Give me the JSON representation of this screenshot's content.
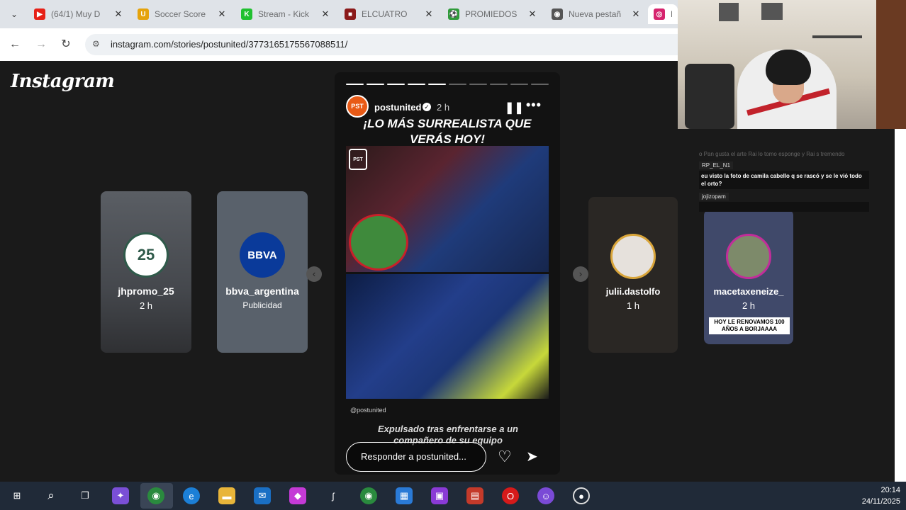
{
  "browser": {
    "tabs": [
      {
        "label": "(64/1) Muy D",
        "icon": "youtube-icon",
        "color": "#e62117",
        "glyph": "▶"
      },
      {
        "label": "Soccer Score",
        "icon": "soccer-score-icon",
        "color": "#e5a30b",
        "glyph": "U"
      },
      {
        "label": "Stream - Kick",
        "icon": "kick-icon",
        "color": "#20c030",
        "glyph": "K"
      },
      {
        "label": "ELCUATRO",
        "icon": "elcuatro-icon",
        "color": "#8b1a1a",
        "glyph": "■"
      },
      {
        "label": "PROMIEDOS",
        "icon": "promiedos-icon",
        "color": "#2f9b3a",
        "glyph": "⚽"
      },
      {
        "label": "Nueva pestañ",
        "icon": "chrome-icon",
        "color": "#555555",
        "glyph": "◉"
      },
      {
        "label": "H",
        "icon": "instagram-icon",
        "color": "#d6246e",
        "glyph": "◎"
      }
    ],
    "url": "instagram.com/stories/postunited/3773165175567088511/"
  },
  "instagram": {
    "logo": "Instagram",
    "left_stories": [
      {
        "name": "jhpromo_25",
        "sub": "2 h",
        "avatar_text": "25"
      },
      {
        "name": "bbva_argentina",
        "sub": "Publicidad",
        "avatar_text": "BBVA"
      }
    ],
    "story": {
      "user": "postunited",
      "avatar_text": "PST",
      "time": "2 h",
      "headline": "¡LO MÁS SURREALISTA QUE VERÁS HOY!",
      "watermark": "@postunited",
      "caption": "Expulsado tras enfrentarse a un compañero de su equipo",
      "reply_placeholder": "Responder a postunited...",
      "progress_total": 10,
      "progress_done": 5
    },
    "right_stories": [
      {
        "name": "julii.dastolfo",
        "sub": "1 h"
      },
      {
        "name": "macetaxeneize_",
        "sub": "2 h",
        "banner": "HOY LE RENOVAMOS 100 AÑOS A BORJAAAA"
      }
    ]
  },
  "chat": {
    "faint": "o Pan gusta el arte Rai lo tomo esponge y Rai s tremendo",
    "messages": [
      {
        "user": "RP_EL_N1",
        "text": "eu visto la foto de camila cabello q se rascó y se le vió todo el orto?"
      },
      {
        "user": "jojizopam",
        "text": ""
      }
    ]
  },
  "taskbar": {
    "time": "20:14",
    "date": "24/11/2025"
  }
}
